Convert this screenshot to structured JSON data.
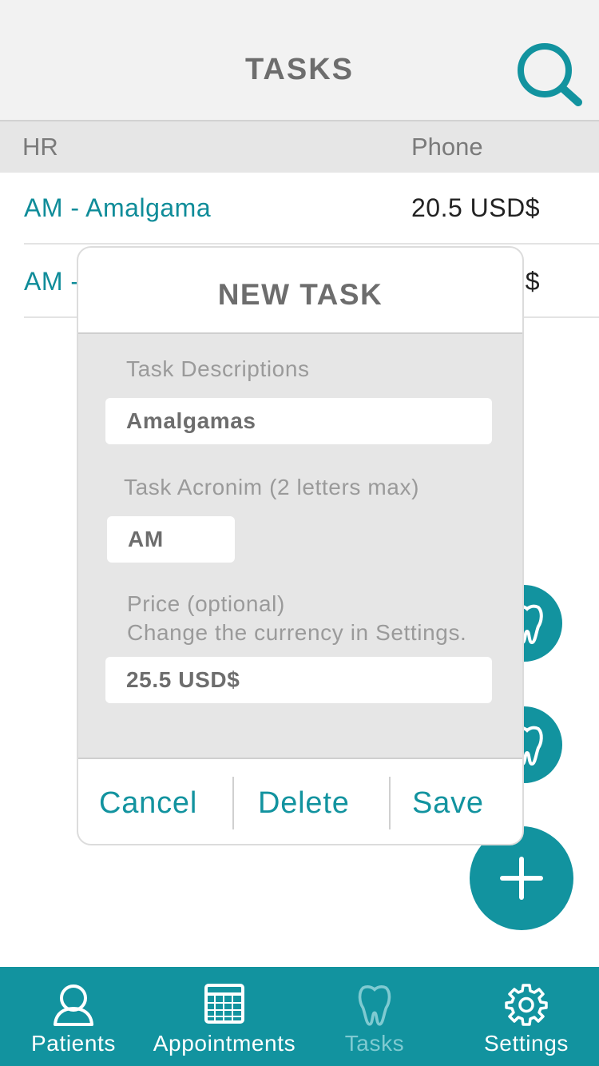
{
  "header": {
    "title": "TASKS",
    "search_icon": "search-icon"
  },
  "columns": {
    "left": "HR",
    "right": "Phone"
  },
  "rows": [
    {
      "name": "AM - Amalgama",
      "price": "20.5 USD$"
    },
    {
      "name": "AM - ",
      "price": "$"
    }
  ],
  "modal": {
    "title": "NEW TASK",
    "desc_label": "Task Descriptions",
    "desc_value": "Amalgamas",
    "acronym_label": "Task Acronim (2 letters max)",
    "acronym_value": "AM",
    "price_label_1": "Price (optional)",
    "price_label_2": "Change the currency in Settings.",
    "price_value": "25.5 USD$",
    "cancel": "Cancel",
    "delete": "Delete",
    "save": "Save"
  },
  "tabs": [
    {
      "label": "Patients",
      "icon": "person-icon"
    },
    {
      "label": "Appointments",
      "icon": "calendar-icon"
    },
    {
      "label": "Tasks",
      "icon": "tooth-icon",
      "active": true
    },
    {
      "label": "Settings",
      "icon": "gear-icon"
    }
  ],
  "colors": {
    "accent": "#12939f",
    "link": "#0f8c99",
    "active_tab": "#7fcad1"
  }
}
